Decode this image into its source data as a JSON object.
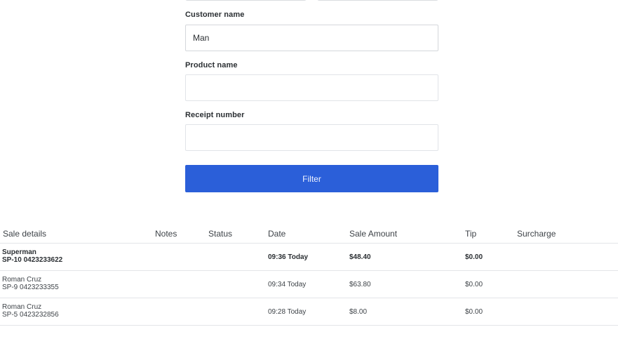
{
  "filters": {
    "customer_name": {
      "label": "Customer name",
      "value": "Man",
      "placeholder": ""
    },
    "product_name": {
      "label": "Product name",
      "value": "",
      "placeholder": ""
    },
    "receipt_number": {
      "label": "Receipt number",
      "value": "",
      "placeholder": ""
    },
    "filter_button": "Filter"
  },
  "table": {
    "headers": [
      "Sale details",
      "Notes",
      "Status",
      "Date",
      "Sale Amount",
      "Tip",
      "Surcharge"
    ],
    "rows": [
      {
        "customer": "Superman",
        "reference": "SP-10 0423233622",
        "notes": "",
        "status": "",
        "date": "09:36 Today",
        "amount": "$48.40",
        "tip": "$0.00",
        "surcharge": "",
        "bold": true
      },
      {
        "customer": "Roman Cruz",
        "reference": "SP-9 0423233355",
        "notes": "",
        "status": "",
        "date": "09:34 Today",
        "amount": "$63.80",
        "tip": "$0.00",
        "surcharge": "",
        "bold": false
      },
      {
        "customer": "Roman Cruz",
        "reference": "SP-5 0423232856",
        "notes": "",
        "status": "",
        "date": "09:28 Today",
        "amount": "$8.00",
        "tip": "$0.00",
        "surcharge": "",
        "bold": false
      }
    ]
  },
  "colors": {
    "primary_button": "#2b5fd9",
    "border": "#e3e5e8"
  }
}
